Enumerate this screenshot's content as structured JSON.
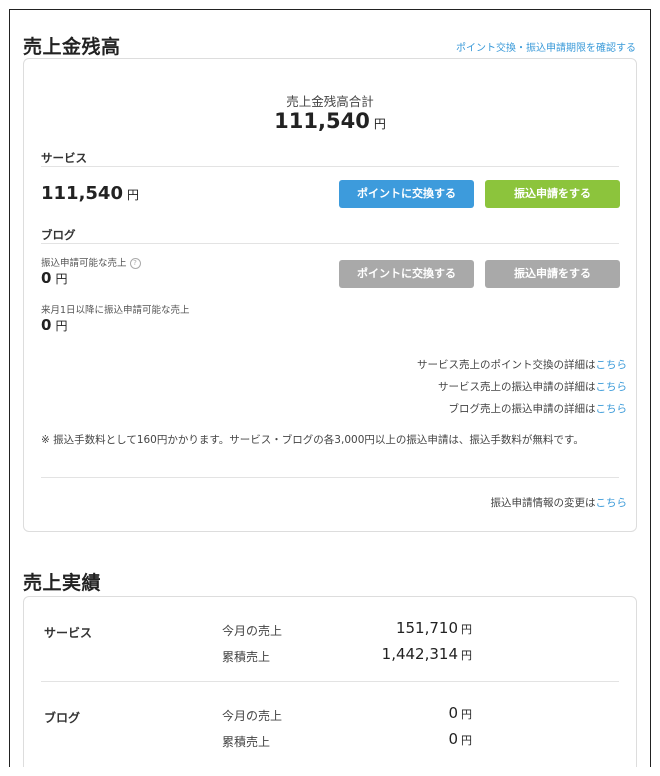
{
  "balance": {
    "title": "売上金残高",
    "top_link": "ポイント交換・振込申請期限を確認する",
    "total_label": "売上金残高合計",
    "total_amount": "111,540",
    "currency": "円",
    "service": {
      "heading": "サービス",
      "amount": "111,540",
      "btn_points": "ポイントに交換する",
      "btn_transfer": "振込申請をする"
    },
    "blog": {
      "heading": "ブログ",
      "available_label": "振込申請可能な売上",
      "available_amount": "0",
      "next_label": "来月1日以降に振込申請可能な売上",
      "next_amount": "0",
      "btn_points": "ポイントに交換する",
      "btn_transfer": "振込申請をする"
    },
    "links": [
      {
        "text": "サービス売上のポイント交換の詳細は",
        "link": "こちら"
      },
      {
        "text": "サービス売上の振込申請の詳細は",
        "link": "こちら"
      },
      {
        "text": "ブログ売上の振込申請の詳細は",
        "link": "こちら"
      }
    ],
    "note": "※ 振込手数料として160円かかります。サービス・ブログの各3,000円以上の振込申請は、振込手数料が無料です。",
    "change_text": "振込申請情報の変更は",
    "change_link": "こちら"
  },
  "sales": {
    "title": "売上実績",
    "currency": "円",
    "rows": [
      {
        "label": "サービス",
        "month_label": "今月の売上",
        "month_value": "151,710",
        "total_label": "累積売上",
        "total_value": "1,442,314"
      },
      {
        "label": "ブログ",
        "month_label": "今月の売上",
        "month_value": "0",
        "total_label": "累積売上",
        "total_value": "0"
      }
    ]
  },
  "colors": {
    "link": "#3a9ad9",
    "btn_blue": "#3d9bdc",
    "btn_green": "#8cc43c",
    "btn_disabled": "#a9a9a9"
  }
}
